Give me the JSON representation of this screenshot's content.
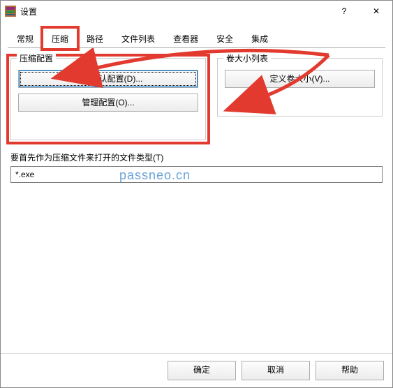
{
  "window": {
    "title": "设置"
  },
  "titlebar": {
    "help_icon": "?",
    "close_icon": "✕"
  },
  "tabs": {
    "general": "常规",
    "compress": "压缩",
    "paths": "路径",
    "filelist": "文件列表",
    "viewer": "查看器",
    "security": "安全",
    "integration": "集成"
  },
  "groups": {
    "compress_profile": "压缩配置",
    "volume_list": "卷大小列表"
  },
  "buttons": {
    "create_default": "创建默认配置(D)...",
    "manage": "管理配置(O)...",
    "define_volume": "定义卷大小(V)...",
    "ok": "确定",
    "cancel": "取消",
    "help": "帮助"
  },
  "labels": {
    "open_as_archive": "要首先作为压缩文件来打开的文件类型(T)"
  },
  "fields": {
    "open_as_archive_value": "*.exe"
  },
  "watermark": "passneo.cn"
}
